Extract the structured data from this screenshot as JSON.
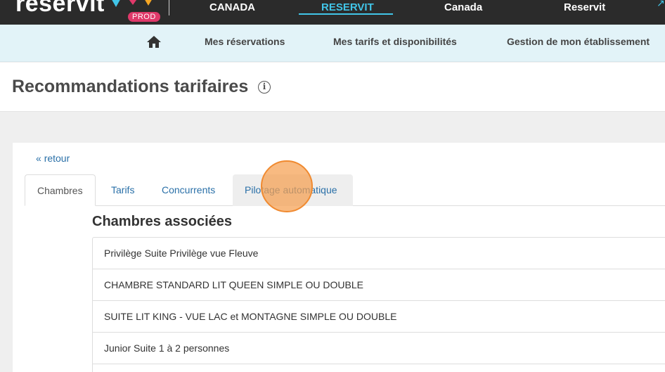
{
  "topbar": {
    "logo_text": "reservit",
    "badge": "PROD",
    "nav": [
      {
        "label": "CANADA"
      },
      {
        "label": "RESERVIT",
        "active": true
      },
      {
        "label": "Canada"
      },
      {
        "label": "Reservit"
      }
    ],
    "accent_color": "#41c5e8"
  },
  "subnav": {
    "home_icon": "home-icon",
    "items": [
      {
        "label": "Mes réservations"
      },
      {
        "label": "Mes tarifs et disponibilités"
      },
      {
        "label": "Gestion de mon établissement"
      }
    ]
  },
  "page": {
    "title": "Recommandations tarifaires",
    "info_icon": "info-icon",
    "info_glyph": "i"
  },
  "content": {
    "back_icon": "double-chevron-left-icon",
    "back_glyph": "«",
    "back_label": "retour",
    "tabs": [
      {
        "label": "Chambres",
        "active": true
      },
      {
        "label": "Tarifs"
      },
      {
        "label": "Concurrents"
      },
      {
        "label": "Pilotage automatique"
      }
    ],
    "section_title": "Chambres associées",
    "rooms": [
      {
        "name": "Privilège Suite Privilège vue Fleuve"
      },
      {
        "name": "CHAMBRE STANDARD LIT QUEEN SIMPLE OU DOUBLE"
      },
      {
        "name": "SUITE LIT KING - VUE LAC et MONTAGNE SIMPLE OU DOUBLE"
      },
      {
        "name": "Junior Suite 1 à 2 personnes"
      }
    ]
  }
}
